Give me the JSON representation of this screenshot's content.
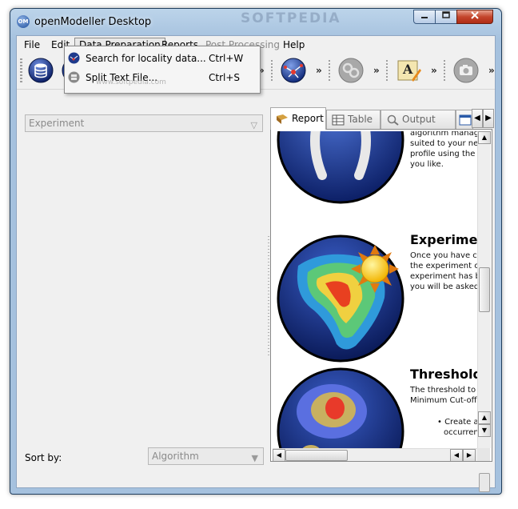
{
  "window": {
    "title": "openModeller Desktop",
    "app_icon": "OM",
    "watermark": "SOFTPEDIA",
    "watermark_url": "www.softpedia.com",
    "controls": {
      "minimize": "minimize-icon",
      "maximize": "maximize-icon",
      "close": "close-icon"
    }
  },
  "menubar": {
    "items": [
      {
        "label": "File"
      },
      {
        "label": "Edit"
      },
      {
        "label": "Data Preparation",
        "state": "open"
      },
      {
        "label": "Reports"
      },
      {
        "label": "Post Processing",
        "state": "disabled"
      },
      {
        "label": "Help"
      }
    ]
  },
  "data_preparation_menu": {
    "items": [
      {
        "label": "Search for locality data...",
        "shortcut": "Ctrl+W",
        "icon": "globe-search-icon"
      },
      {
        "label": "Split Text File...",
        "shortcut": "Ctrl+S",
        "icon": "split-file-icon"
      }
    ]
  },
  "toolbar": {
    "overflow_glyph": "»",
    "icons": [
      "database-icon",
      "globe-icon",
      "network-globe-icon",
      "gears-icon",
      "text-editor-icon",
      "camera-icon"
    ]
  },
  "left_panel": {
    "experiment_combo": "Experiment",
    "sort_by_label": "Sort by:",
    "sort_by_value": "Algorithm"
  },
  "right_panel": {
    "tabs": [
      {
        "label": "Report",
        "active": true,
        "icon": "report-icon"
      },
      {
        "label": "Table",
        "icon": "table-icon"
      },
      {
        "label": "Output Map",
        "icon": "map-icon"
      },
      {
        "label": "",
        "icon": "window-icon"
      }
    ],
    "report": {
      "section1_lines": [
        "algorithm manag",
        "suited to your ne",
        "profile using the",
        "you like."
      ],
      "section2_heading": "Experime",
      "section2_lines": [
        "Once you have c",
        "the experiment c",
        "experiment has b",
        "you will be asked"
      ],
      "section3_heading": "Threshold",
      "section3_lines": [
        "The threshold to",
        "Minimum Cut-off"
      ],
      "section3_bullet": "• Create a",
      "section3_bullet_cont": "occurren"
    }
  },
  "colors": {
    "window_frame": "#a5c1de",
    "close_button": "#c4452c",
    "globe_blue": "#1e3a8c",
    "sun_yellow": "#f2b400"
  }
}
